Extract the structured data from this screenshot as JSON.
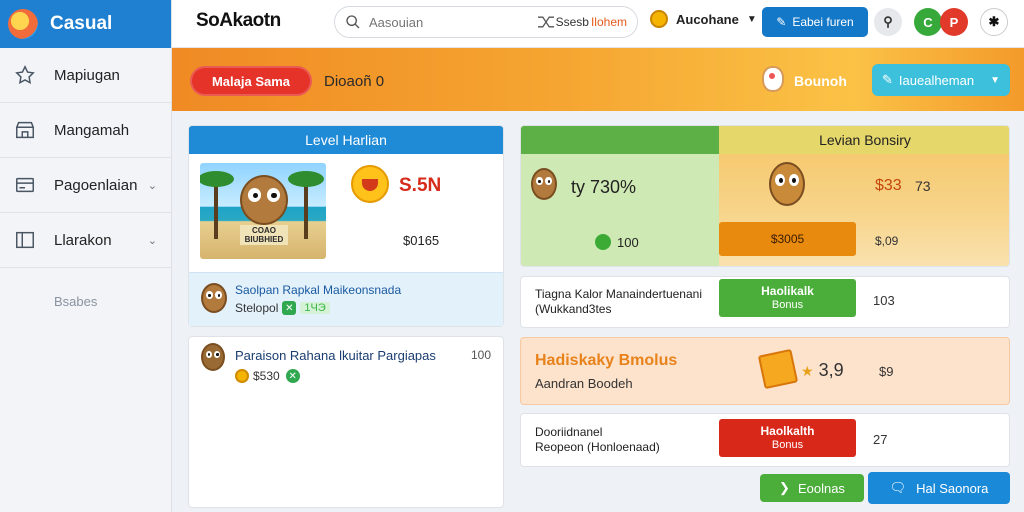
{
  "sidebar": {
    "brand": "Casual",
    "items": [
      {
        "label": "Mapiugan",
        "icon": "star-icon",
        "chevron": false
      },
      {
        "label": "Mangamah",
        "icon": "store-icon",
        "chevron": false
      },
      {
        "label": "Pagoenlaian",
        "icon": "card-icon",
        "chevron": true
      },
      {
        "label": "Llarakon",
        "icon": "layout-icon",
        "chevron": true
      }
    ],
    "section_label": "Bsabes"
  },
  "topbar": {
    "title": "SoAkaotn",
    "search_placeholder": "Aasouian",
    "search_tag": "Ssesb",
    "search_tag_accent": "Ilohem",
    "user_name": "Aucohane",
    "button_label": "Eabei furen",
    "circle_labels": [
      "P",
      "C",
      "P"
    ]
  },
  "banner": {
    "pill_label": "Malaja Sama",
    "text": "Dioaoñ 0",
    "label": "Bounoh",
    "select_value": "Iauealheman"
  },
  "level_card": {
    "header": "Level Harlian",
    "photo_caption": "COAO BIUBHIED",
    "red_value": "S.5N",
    "amount": "$0165",
    "sub_title": "Saolpan Rapkal Maikeonsnada",
    "sub_row_text": "Stelopol",
    "sub_row_chip": "1ЧЭ"
  },
  "offer_card": {
    "title": "Paraison Rahana lkuitar Pargiapas",
    "count": "100",
    "amount": "$530"
  },
  "bonus_panel": {
    "header": "Levian Bonsiry",
    "rate": "ty 730%",
    "points": "100",
    "price": "$33",
    "price_sub": "73",
    "orange_button": "$3005",
    "value": "$,09"
  },
  "tasks": [
    {
      "line1": "Tiagna Kalor Manaindertuenani",
      "line2": "(Wukkand3tes",
      "btn_line1": "Haolikalk",
      "btn_line2": "Bonus",
      "btn_color": "#4cae3a",
      "num": "103"
    },
    {
      "line1": "Dooriidnanel",
      "line2": "Reopeon (Honloenaad)",
      "btn_line1": "Haolkalth",
      "btn_line2": "Bonus",
      "btn_color": "#d8281a",
      "num": "27"
    }
  ],
  "promo": {
    "title": "Hadiskaky Bmolus",
    "subtitle": "Aandran Boodeh",
    "value": "3,9",
    "num": "$9"
  },
  "floating": {
    "left_label": "Eoolnas",
    "right_label": "Hal Saonora"
  },
  "colors": {
    "brand_blue": "#1f7fd0",
    "banner_orange": "#f5a531",
    "green": "#4cae3a",
    "red": "#d8281a"
  }
}
